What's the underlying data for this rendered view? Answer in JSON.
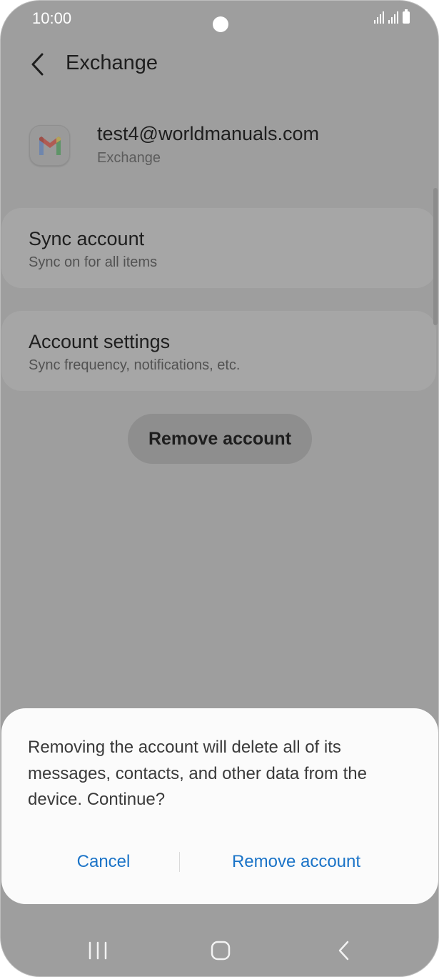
{
  "status_bar": {
    "time": "10:00"
  },
  "header": {
    "back_icon": "chevron-left-icon",
    "title": "Exchange"
  },
  "account": {
    "icon": "gmail-icon",
    "email": "test4@worldmanuals.com",
    "type": "Exchange"
  },
  "menu": {
    "sync": {
      "title": "Sync account",
      "subtitle": "Sync on for all items"
    },
    "settings": {
      "title": "Account settings",
      "subtitle": "Sync frequency, notifications, etc."
    },
    "remove_label": "Remove account"
  },
  "dialog": {
    "message": "Removing the account will delete all of its messages, contacts, and other data from the device. Continue?",
    "cancel_label": "Cancel",
    "confirm_label": "Remove account"
  },
  "nav_bar": {
    "recents_icon": "recents-icon",
    "home_icon": "home-icon",
    "back_icon": "back-icon"
  },
  "colors": {
    "background_dim": "#9e9e9e",
    "dialog_background": "#fbfbfb",
    "accent": "#1a73c7",
    "text_primary": "#1e1e1e"
  }
}
